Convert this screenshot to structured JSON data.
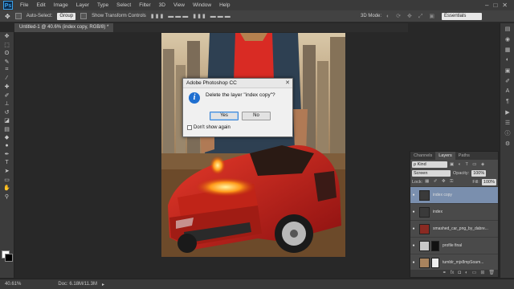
{
  "app": {
    "logo": "Ps"
  },
  "menu": [
    "File",
    "Edit",
    "Image",
    "Layer",
    "Type",
    "Select",
    "Filter",
    "3D",
    "View",
    "Window",
    "Help"
  ],
  "window_controls": [
    "–",
    "□",
    "✕"
  ],
  "options_bar": {
    "auto_select_label": "Auto-Select:",
    "auto_select_value": "Group",
    "show_transform_label": "Show Transform Controls",
    "mode_3d_label": "3D Mode:",
    "workspace": "Essentials"
  },
  "document_tab": {
    "title": "Untitled-1 @ 40.6% (index copy, RGB/8) *"
  },
  "dialog": {
    "title": "Adobe Photoshop CC",
    "message": "Delete the layer \"index copy\"?",
    "yes_label": "Yes",
    "no_label": "No",
    "dont_show_label": "Don't show again"
  },
  "layers_panel": {
    "tabs": [
      "Channels",
      "Layers",
      "Paths"
    ],
    "active_tab": "Layers",
    "kind_label": "ρ Kind",
    "blend_mode": "Screen",
    "opacity_label": "Opacity:",
    "opacity_value": "100%",
    "lock_label": "Lock:",
    "fill_label": "Fill:",
    "fill_value": "100%",
    "layers": [
      {
        "name": "index copy",
        "selected": true
      },
      {
        "name": "index",
        "selected": false
      },
      {
        "name": "smashed_car_png_by_dabre...",
        "selected": false
      },
      {
        "name": "profile final",
        "selected": false
      },
      {
        "name": "tumblr_mjx8mpSoam...",
        "selected": false
      }
    ]
  },
  "status": {
    "zoom": "40.61%",
    "doc_info": "Doc: 6.18M/11.3M"
  },
  "colors": {
    "menubar": "#3a3a3a",
    "accent": "#3aa0e8",
    "selected_layer": "#7a8fae",
    "info_icon": "#1f6fd0"
  }
}
